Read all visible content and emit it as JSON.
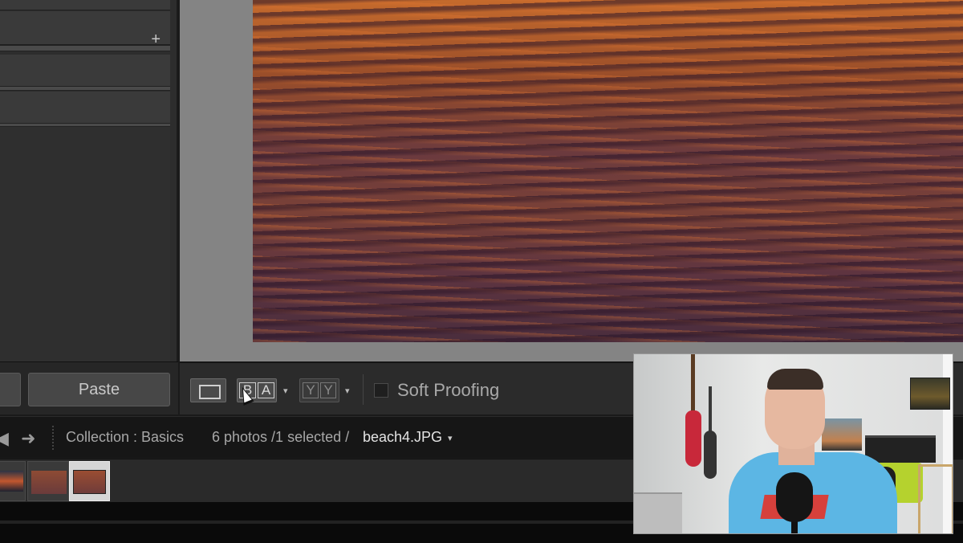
{
  "left_panel": {
    "icons": [
      "plus-icon",
      "close-icon",
      "minus-icon",
      "plus-icon"
    ],
    "paste_label": "Paste"
  },
  "toolbar": {
    "before_letter": "B",
    "after_letter": "A",
    "yy_left": "Y",
    "yy_right": "Y",
    "soft_proofing_label": "Soft Proofing",
    "soft_proofing_checked": false
  },
  "filmstrip": {
    "collection_label": "Collection : Basics",
    "photo_count": "6 photos /1 selected /",
    "filename": "beach4.JPG",
    "thumbnails": 3,
    "selected_index": 2
  },
  "colors": {
    "panel_bg": "#2d2d2d",
    "workspace_bg": "#848484",
    "filmstrip_bg": "#161616"
  }
}
